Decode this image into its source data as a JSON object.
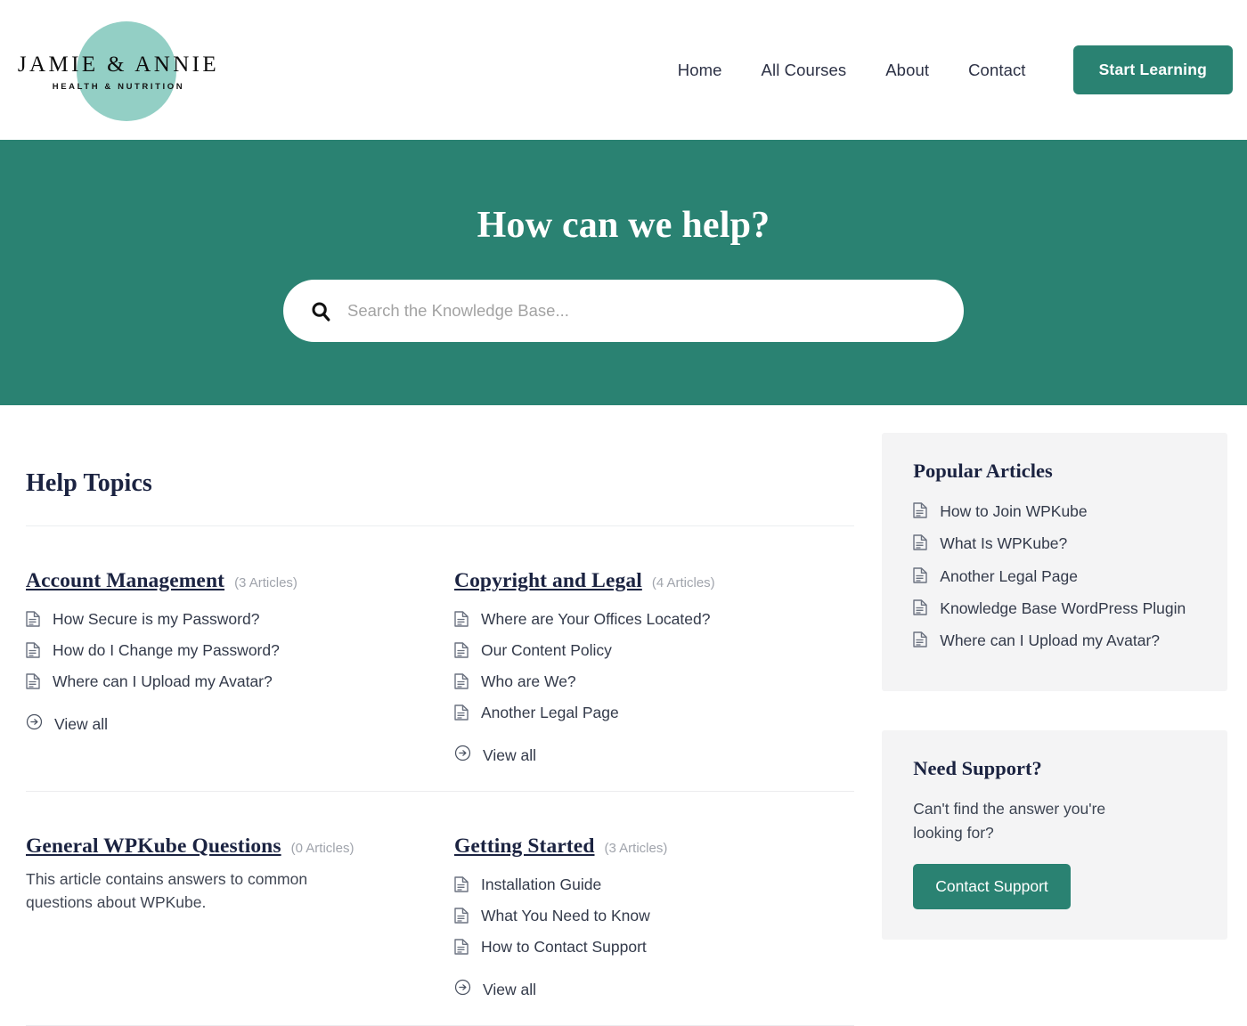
{
  "header": {
    "logo": {
      "main": "JAMIE & ANNIE",
      "sub": "HEALTH & NUTRITION",
      "circle_color": "#93cfc5"
    },
    "nav": [
      {
        "label": "Home"
      },
      {
        "label": "All Courses"
      },
      {
        "label": "About"
      },
      {
        "label": "Contact"
      }
    ],
    "cta_label": "Start Learning"
  },
  "hero": {
    "title": "How can we help?",
    "search_placeholder": "Search the Knowledge Base...",
    "search_value": "",
    "background_color": "#2a8272"
  },
  "main": {
    "section_title": "Help Topics",
    "view_all_label": "View all",
    "topics": [
      {
        "name": "Account Management",
        "count": "(3 Articles)",
        "description": "",
        "articles": [
          "How Secure is my Password?",
          "How do I Change my Password?",
          "Where can I Upload my Avatar?"
        ],
        "has_view_all": true
      },
      {
        "name": "Copyright and Legal",
        "count": "(4 Articles)",
        "description": "",
        "articles": [
          "Where are Your Offices Located?",
          "Our Content Policy",
          "Who are We?",
          "Another Legal Page"
        ],
        "has_view_all": true
      },
      {
        "name": "General WPKube Questions",
        "count": "(0 Articles)",
        "description": "This article contains answers to common questions about WPKube.",
        "articles": [],
        "has_view_all": false
      },
      {
        "name": "Getting Started",
        "count": "(3 Articles)",
        "description": "",
        "articles": [
          "Installation Guide",
          "What You Need to Know",
          "How to Contact Support"
        ],
        "has_view_all": true
      }
    ]
  },
  "sidebar": {
    "popular": {
      "title": "Popular Articles",
      "articles": [
        "How to Join WPKube",
        "What Is WPKube?",
        "Another Legal Page",
        "Knowledge Base WordPress Plugin",
        "Where can I Upload my Avatar?"
      ]
    },
    "support": {
      "title": "Need Support?",
      "text": "Can't find the answer you're looking for?",
      "button_label": "Contact Support"
    }
  },
  "colors": {
    "brand_green": "#2a8272",
    "logo_teal": "#93cfc5",
    "heading_navy": "#1b2341",
    "panel_gray": "#f4f4f5"
  }
}
